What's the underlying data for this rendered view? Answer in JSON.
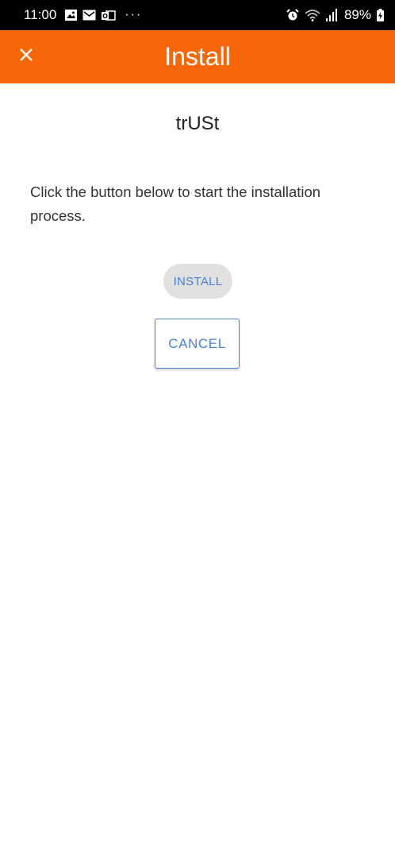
{
  "status_bar": {
    "time": "11:00",
    "battery": "89%",
    "left_icons": [
      "image-icon",
      "mail-icon",
      "outlook-icon",
      "more-dots-icon"
    ],
    "right_icons": [
      "alarm-icon",
      "wifi-icon",
      "signal-icon",
      "battery-icon"
    ]
  },
  "app_bar": {
    "title": "Install",
    "close_icon": "close-icon",
    "color": "#f7670a"
  },
  "main": {
    "app_name": "trUSt",
    "instructions": "Click the button below to start the installation process.",
    "install_label": "INSTALL",
    "cancel_label": "CANCEL"
  },
  "colors": {
    "accent": "#4a80cf",
    "install_bg": "#e0e0e0"
  }
}
